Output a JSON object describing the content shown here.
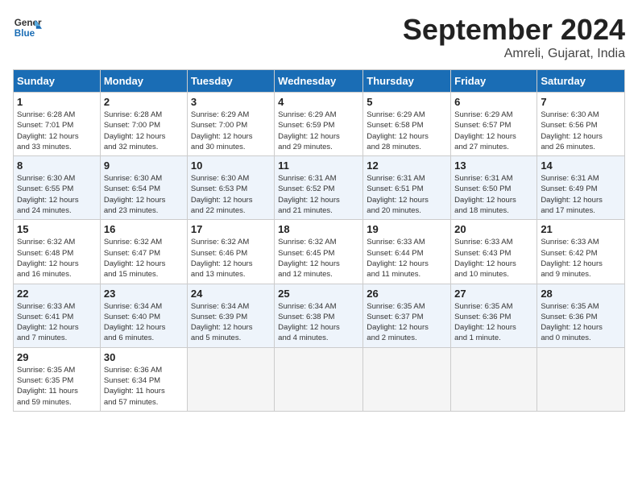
{
  "header": {
    "logo_line1": "General",
    "logo_line2": "Blue",
    "month": "September 2024",
    "location": "Amreli, Gujarat, India"
  },
  "weekdays": [
    "Sunday",
    "Monday",
    "Tuesday",
    "Wednesday",
    "Thursday",
    "Friday",
    "Saturday"
  ],
  "weeks": [
    [
      {
        "day": "1",
        "info": "Sunrise: 6:28 AM\nSunset: 7:01 PM\nDaylight: 12 hours\nand 33 minutes."
      },
      {
        "day": "2",
        "info": "Sunrise: 6:28 AM\nSunset: 7:00 PM\nDaylight: 12 hours\nand 32 minutes."
      },
      {
        "day": "3",
        "info": "Sunrise: 6:29 AM\nSunset: 7:00 PM\nDaylight: 12 hours\nand 30 minutes."
      },
      {
        "day": "4",
        "info": "Sunrise: 6:29 AM\nSunset: 6:59 PM\nDaylight: 12 hours\nand 29 minutes."
      },
      {
        "day": "5",
        "info": "Sunrise: 6:29 AM\nSunset: 6:58 PM\nDaylight: 12 hours\nand 28 minutes."
      },
      {
        "day": "6",
        "info": "Sunrise: 6:29 AM\nSunset: 6:57 PM\nDaylight: 12 hours\nand 27 minutes."
      },
      {
        "day": "7",
        "info": "Sunrise: 6:30 AM\nSunset: 6:56 PM\nDaylight: 12 hours\nand 26 minutes."
      }
    ],
    [
      {
        "day": "8",
        "info": "Sunrise: 6:30 AM\nSunset: 6:55 PM\nDaylight: 12 hours\nand 24 minutes."
      },
      {
        "day": "9",
        "info": "Sunrise: 6:30 AM\nSunset: 6:54 PM\nDaylight: 12 hours\nand 23 minutes."
      },
      {
        "day": "10",
        "info": "Sunrise: 6:30 AM\nSunset: 6:53 PM\nDaylight: 12 hours\nand 22 minutes."
      },
      {
        "day": "11",
        "info": "Sunrise: 6:31 AM\nSunset: 6:52 PM\nDaylight: 12 hours\nand 21 minutes."
      },
      {
        "day": "12",
        "info": "Sunrise: 6:31 AM\nSunset: 6:51 PM\nDaylight: 12 hours\nand 20 minutes."
      },
      {
        "day": "13",
        "info": "Sunrise: 6:31 AM\nSunset: 6:50 PM\nDaylight: 12 hours\nand 18 minutes."
      },
      {
        "day": "14",
        "info": "Sunrise: 6:31 AM\nSunset: 6:49 PM\nDaylight: 12 hours\nand 17 minutes."
      }
    ],
    [
      {
        "day": "15",
        "info": "Sunrise: 6:32 AM\nSunset: 6:48 PM\nDaylight: 12 hours\nand 16 minutes."
      },
      {
        "day": "16",
        "info": "Sunrise: 6:32 AM\nSunset: 6:47 PM\nDaylight: 12 hours\nand 15 minutes."
      },
      {
        "day": "17",
        "info": "Sunrise: 6:32 AM\nSunset: 6:46 PM\nDaylight: 12 hours\nand 13 minutes."
      },
      {
        "day": "18",
        "info": "Sunrise: 6:32 AM\nSunset: 6:45 PM\nDaylight: 12 hours\nand 12 minutes."
      },
      {
        "day": "19",
        "info": "Sunrise: 6:33 AM\nSunset: 6:44 PM\nDaylight: 12 hours\nand 11 minutes."
      },
      {
        "day": "20",
        "info": "Sunrise: 6:33 AM\nSunset: 6:43 PM\nDaylight: 12 hours\nand 10 minutes."
      },
      {
        "day": "21",
        "info": "Sunrise: 6:33 AM\nSunset: 6:42 PM\nDaylight: 12 hours\nand 9 minutes."
      }
    ],
    [
      {
        "day": "22",
        "info": "Sunrise: 6:33 AM\nSunset: 6:41 PM\nDaylight: 12 hours\nand 7 minutes."
      },
      {
        "day": "23",
        "info": "Sunrise: 6:34 AM\nSunset: 6:40 PM\nDaylight: 12 hours\nand 6 minutes."
      },
      {
        "day": "24",
        "info": "Sunrise: 6:34 AM\nSunset: 6:39 PM\nDaylight: 12 hours\nand 5 minutes."
      },
      {
        "day": "25",
        "info": "Sunrise: 6:34 AM\nSunset: 6:38 PM\nDaylight: 12 hours\nand 4 minutes."
      },
      {
        "day": "26",
        "info": "Sunrise: 6:35 AM\nSunset: 6:37 PM\nDaylight: 12 hours\nand 2 minutes."
      },
      {
        "day": "27",
        "info": "Sunrise: 6:35 AM\nSunset: 6:36 PM\nDaylight: 12 hours\nand 1 minute."
      },
      {
        "day": "28",
        "info": "Sunrise: 6:35 AM\nSunset: 6:36 PM\nDaylight: 12 hours\nand 0 minutes."
      }
    ],
    [
      {
        "day": "29",
        "info": "Sunrise: 6:35 AM\nSunset: 6:35 PM\nDaylight: 11 hours\nand 59 minutes."
      },
      {
        "day": "30",
        "info": "Sunrise: 6:36 AM\nSunset: 6:34 PM\nDaylight: 11 hours\nand 57 minutes."
      },
      null,
      null,
      null,
      null,
      null
    ]
  ]
}
